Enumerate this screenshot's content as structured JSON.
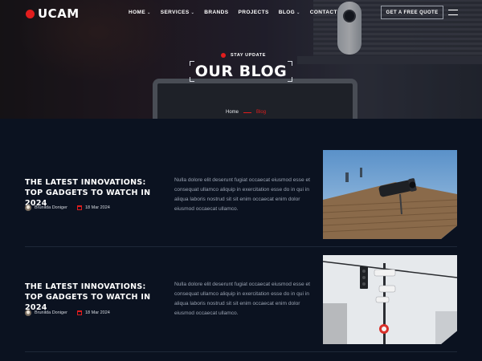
{
  "brand": {
    "name": "UCAM"
  },
  "nav": {
    "items": [
      {
        "label": "HOME",
        "has_dropdown": true
      },
      {
        "label": "SERVICES",
        "has_dropdown": true
      },
      {
        "label": "BRANDS",
        "has_dropdown": false
      },
      {
        "label": "PROJECTS",
        "has_dropdown": false
      },
      {
        "label": "BLOG",
        "has_dropdown": true
      },
      {
        "label": "CONTACT",
        "has_dropdown": false
      }
    ],
    "cta_label": "GET A FREE QUOTE"
  },
  "hero": {
    "eyebrow": "STAY UPDATE",
    "title": "OUR BLOG",
    "breadcrumb": {
      "home": "Home",
      "current": "Blog"
    }
  },
  "posts": [
    {
      "title": "THE LATEST INNOVATIONS: TOP GADGETS TO WATCH IN 2024",
      "author": "Brunilda Doniger",
      "date": "18 Mar 2024",
      "excerpt": "Nulla dolore elit deserunt fugiat occaecat eiusmod esse et consequat ullamco aliquip in exercitation esse do in qui in aliqua laboris nostrud sit sit enim occaecat enim dolor eiusmod occaecat ullamco."
    },
    {
      "title": "THE LATEST INNOVATIONS: TOP GADGETS TO WATCH IN 2024",
      "author": "Brunilda Doniger",
      "date": "18 Mar 2024",
      "excerpt": "Nulla dolore elit deserunt fugiat occaecat eiusmod esse et consequat ullamco aliquip in exercitation esse do in qui in aliqua laboris nostrud sit sit enim occaecat enim dolor eiusmod occaecat ullamco."
    }
  ],
  "colors": {
    "accent": "#e11d1d",
    "background": "#0b1220",
    "muted_text": "#9aa3b2"
  },
  "icons": {
    "menu": "hamburger-icon",
    "calendar": "calendar-icon",
    "dropdown": "chevron-down-icon"
  }
}
